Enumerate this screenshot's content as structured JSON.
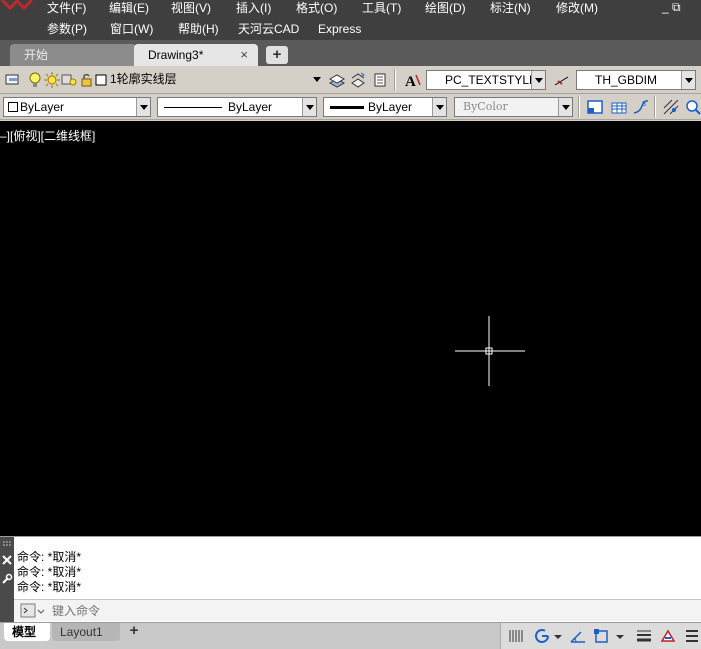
{
  "menubar": {
    "row1": [
      "文件(F)",
      "编辑(E)",
      "视图(V)",
      "插入(I)",
      "格式(O)",
      "工具(T)",
      "绘图(D)",
      "标注(N)",
      "修改(M)"
    ],
    "row2": [
      "参数(P)",
      "窗口(W)",
      "帮助(H)",
      "天河云CAD",
      "Express"
    ],
    "window_controls": "_ ⧉"
  },
  "tabs": {
    "start": "开始",
    "drawing": "Drawing3*",
    "close": "×",
    "add": "+"
  },
  "toolbar1": {
    "layer": "1轮廓实线层",
    "text_style": "PC_TEXTSTYLE",
    "dim_style": "TH_GBDIM"
  },
  "toolbar2": {
    "color": "ByLayer",
    "linetype": "ByLayer",
    "lineweight": "ByLayer",
    "plotstyle": "ByColor"
  },
  "canvas": {
    "viewport_label": "–][俯视][二维线框]",
    "background": "#000000"
  },
  "command": {
    "history": [
      "命令: *取消*",
      "命令: *取消*",
      "命令: *取消*"
    ],
    "placeholder": "键入命令"
  },
  "layout_tabs": {
    "model": "模型",
    "layout1": "Layout1",
    "add": "+"
  },
  "colors": {
    "menubar": "#3f3f3f",
    "toolbar": "#d4d0c8",
    "canvas": "#000000",
    "accent_blue": "#1c5fc7"
  }
}
